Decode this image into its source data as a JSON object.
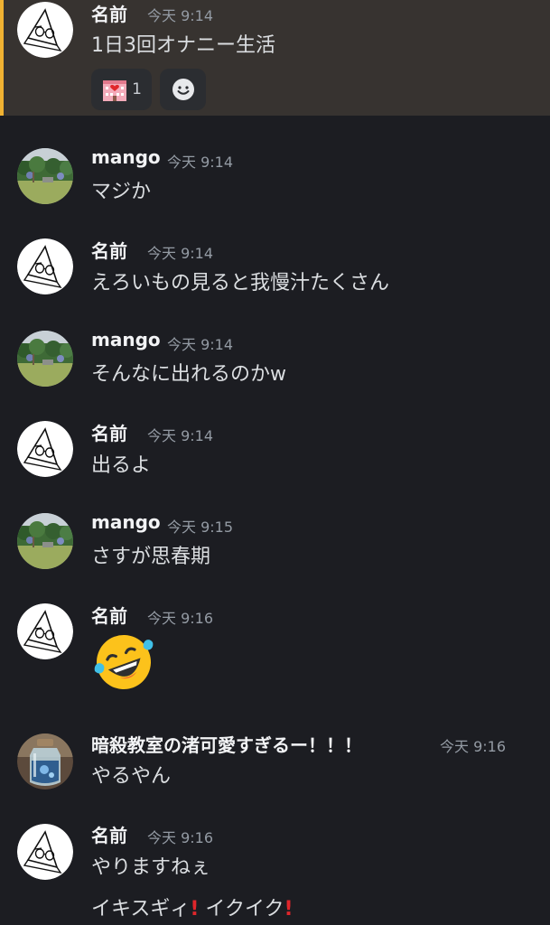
{
  "messages": [
    {
      "username": "名前",
      "timestamp": "今天 9:14",
      "lines": [
        "1日3回オナニー生活"
      ],
      "reactions": [
        {
          "icon": "hospital-love-emoji",
          "count": "1"
        },
        {
          "icon": "add-reaction-smiley-icon"
        }
      ]
    },
    {
      "username": "mango",
      "timestamp": "今天 9:14",
      "lines": [
        "マジか"
      ]
    },
    {
      "username": "名前",
      "timestamp": "今天 9:14",
      "lines": [
        "えろいもの見ると我慢汁たくさん"
      ]
    },
    {
      "username": "mango",
      "timestamp": "今天 9:14",
      "lines": [
        "そんなに出れるのかw"
      ]
    },
    {
      "username": "名前",
      "timestamp": "今天 9:14",
      "lines": [
        "出るよ"
      ]
    },
    {
      "username": "mango",
      "timestamp": "今天 9:15",
      "lines": [
        "さすが思春期"
      ]
    },
    {
      "username": "名前",
      "timestamp": "今天 9:16",
      "emoji": "rolling-on-floor-laughing-emoji"
    },
    {
      "username": "暗殺教室の渚可愛すぎるー！！！",
      "timestamp": "今天 9:16",
      "lines": [
        "やるやん"
      ]
    },
    {
      "username": "名前",
      "timestamp": "今天 9:16",
      "lines": [
        "やりますねぇ"
      ],
      "extra": {
        "part1": "イキスギィ",
        "part2": " イクイク",
        "mark_icon": "red-exclamation-icon"
      }
    }
  ],
  "colors": {
    "highlight_bar": "#f0b232",
    "background": "#1c1d22",
    "username": "#f2f3f5",
    "timestamp": "#949ba4"
  }
}
